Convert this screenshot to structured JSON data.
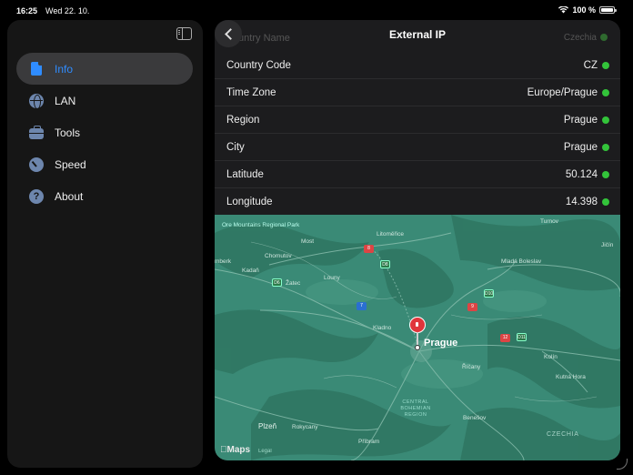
{
  "status_bar": {
    "time": "16:25",
    "date": "Wed 22. 10.",
    "battery": "100 %"
  },
  "sidebar": {
    "items": [
      {
        "label": "Info",
        "icon": "document-icon",
        "active": true
      },
      {
        "label": "LAN",
        "icon": "globe-icon",
        "active": false
      },
      {
        "label": "Tools",
        "icon": "toolbox-icon",
        "active": false
      },
      {
        "label": "Speed",
        "icon": "gauge-icon",
        "active": false
      },
      {
        "label": "About",
        "icon": "info-icon",
        "active": false
      }
    ]
  },
  "detail": {
    "title": "External IP",
    "ghost_row": {
      "label": "Country Name",
      "value": "Czechia"
    },
    "rows": [
      {
        "label": "Country Code",
        "value": "CZ"
      },
      {
        "label": "Time Zone",
        "value": "Europe/Prague"
      },
      {
        "label": "Region",
        "value": "Prague"
      },
      {
        "label": "City",
        "value": "Prague"
      },
      {
        "label": "Latitude",
        "value": "50.124"
      },
      {
        "label": "Longitude",
        "value": "14.398"
      }
    ],
    "status_color": "#33c43a"
  },
  "map": {
    "city": "Prague",
    "logo": "Maps",
    "legal": "Legal",
    "labels": {
      "park": "Ore Mountains Regional Park",
      "most": "Most",
      "chomutov": "Chomutov",
      "kadan": "Kadaň",
      "zatec": "Žatec",
      "louny": "Louny",
      "litomerice": "Litoměřice",
      "mlada": "Mladá Boleslav",
      "turnov": "Turnov",
      "jicin": "Jičín",
      "kladno": "Kladno",
      "kolin": "Kolín",
      "kutna": "Kutná Hora",
      "ricany": "Říčany",
      "benesov": "Benešov",
      "rokycany": "Rokycany",
      "plzen": "Plzeň",
      "pribram": "Příbram",
      "region": "CENTRAL BOHEMIAN REGION",
      "country": "CZECHIA",
      "jirkov": "mberk"
    },
    "colors": {
      "land": "#3a8a76",
      "forest": "#2f7561",
      "road": "#8cc0b0"
    }
  }
}
